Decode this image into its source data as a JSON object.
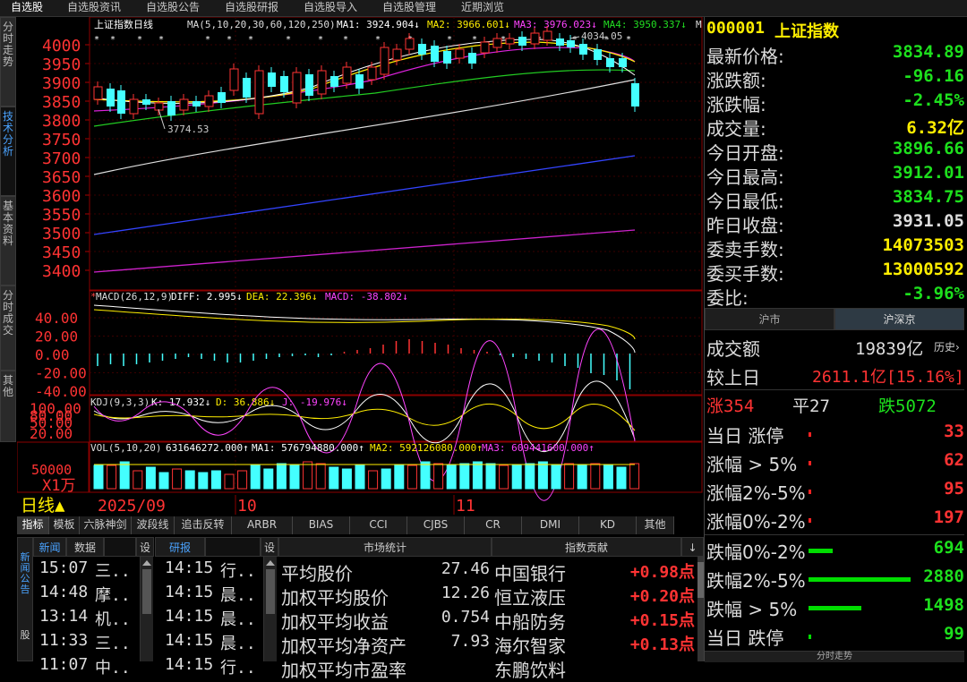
{
  "menu": [
    "自选股",
    "自选股资讯",
    "自选股公告",
    "自选股研报",
    "自选股导入",
    "自选股管理",
    "近期浏览"
  ],
  "left_tabs": [
    "分时走势",
    "技术分析",
    "基本资料",
    "分时成交",
    "其他"
  ],
  "main_chart": {
    "header": "上证指数日线",
    "ma_label": "MA(5,10,20,30,60,120,250)",
    "ma1": "MA1: 3924.904↓",
    "ma2": "MA2: 3966.601↓",
    "ma3": "MA3: 3976.023↓",
    "ma4": "MA4: 3950.337↓",
    "ma5": "M",
    "yticks": [
      "4000",
      "3950",
      "3900",
      "3850",
      "3800",
      "3750",
      "3700",
      "3650",
      "3600",
      "3550",
      "3500",
      "3450",
      "3400"
    ],
    "high_label": "4034.05",
    "low_label": "3774.53"
  },
  "macd": {
    "label": "MACD(26,12,9)",
    "diff": "DIFF: 2.995↓",
    "dea": "DEA: 22.396↓",
    "macd": "MACD: -38.802↓",
    "yticks": [
      "40.00",
      "20.00",
      "0.00",
      "-20.00",
      "-40.00"
    ]
  },
  "kdj": {
    "label": "KDJ(9,3,3)",
    "k": "K: 17.932↓",
    "d": "D: 36.886↓",
    "j": "J: -19.976↓",
    "yticks": [
      "100.00",
      "80.00",
      "50.00",
      "20.00"
    ]
  },
  "vol": {
    "label": "VOL(5,10,20)",
    "v": "631646272.000↑",
    "ma1": "MA1: 576794880.000↑",
    "ma2": "MA2: 592126080.000↑",
    "ma3": "MA3: 609441600.000↑",
    "ytick": "50000",
    "unit": "X1万"
  },
  "timeline": {
    "period": "日线▲",
    "d1": "2025/09",
    "d2": "10",
    "d3": "11"
  },
  "indicator_tabs": [
    "指标",
    "模板",
    "六脉神剑",
    "波段线",
    "追击反转",
    "ARBR",
    "BIAS",
    "CCI",
    "CJBS",
    "CR",
    "DMI",
    "KD",
    "其他"
  ],
  "quote": {
    "code": "000001",
    "name": "上证指数",
    "rows": [
      {
        "label": "最新价格:",
        "value": "3834.89",
        "color": "green"
      },
      {
        "label": "涨跌额:",
        "value": "-96.16",
        "color": "green"
      },
      {
        "label": "涨跌幅:",
        "value": "-2.45%",
        "color": "green"
      },
      {
        "label": "成交量:",
        "value": "6.32亿",
        "color": "yellow"
      },
      {
        "label": "今日开盘:",
        "value": "3896.66",
        "color": "green"
      },
      {
        "label": "今日最高:",
        "value": "3912.01",
        "color": "green"
      },
      {
        "label": "今日最低:",
        "value": "3834.75",
        "color": "green"
      },
      {
        "label": "昨日收盘:",
        "value": "3931.05",
        "color": "white"
      },
      {
        "label": "委卖手数:",
        "value": "14073503",
        "color": "yellow"
      },
      {
        "label": "委买手数:",
        "value": "13000592",
        "color": "yellow"
      },
      {
        "label": "委比:",
        "value": "-3.96%",
        "color": "green"
      }
    ]
  },
  "market_tabs": [
    "沪市",
    "沪深京"
  ],
  "turnover": {
    "label": "成交额",
    "value": "19839亿",
    "hist": "历史›",
    "cmp_label": "较上日",
    "cmp_value": "2611.1亿[15.16%]"
  },
  "breadth": {
    "up": "涨354",
    "flat": "平27",
    "down": "跌5072"
  },
  "dist": [
    {
      "label": "当日 涨停",
      "value": "33",
      "color": "red",
      "fill": 0.005
    },
    {
      "label": "涨幅 > 5%",
      "value": "62",
      "color": "red",
      "fill": 0.01
    },
    {
      "label": "涨幅2%-5%",
      "value": "95",
      "color": "red",
      "fill": 0.015
    },
    {
      "label": "涨幅0%-2%",
      "value": "197",
      "color": "red",
      "fill": 0.03
    },
    {
      "label": "跌幅0%-2%",
      "value": "694",
      "color": "green",
      "fill": 0.24
    },
    {
      "label": "跌幅2%-5%",
      "value": "2880",
      "color": "green",
      "fill": 1.0
    },
    {
      "label": "跌幅 > 5%",
      "value": "1498",
      "color": "green",
      "fill": 0.52
    },
    {
      "label": "当日 跌停",
      "value": "99",
      "color": "green",
      "fill": 0.03
    }
  ],
  "bottom_right_label": "分时走势",
  "news": {
    "tabs": [
      "新闻",
      "数据",
      "设"
    ],
    "side": [
      "新闻公告",
      "股"
    ],
    "items": [
      {
        "t": "15:07",
        "s": "三.."
      },
      {
        "t": "14:48",
        "s": "摩.."
      },
      {
        "t": "13:14",
        "s": "机.."
      },
      {
        "t": "11:33",
        "s": "三.."
      },
      {
        "t": "11:07",
        "s": "中.."
      }
    ]
  },
  "reports": {
    "tabs": [
      "研报",
      "设"
    ],
    "items": [
      {
        "t": "14:15",
        "s": "行.."
      },
      {
        "t": "14:15",
        "s": "晨.."
      },
      {
        "t": "14:15",
        "s": "晨.."
      },
      {
        "t": "14:15",
        "s": "晨.."
      },
      {
        "t": "14:15",
        "s": "行.."
      }
    ]
  },
  "stats": {
    "title": "市场统计",
    "rows": [
      {
        "label": "平均股价",
        "value": "27.46"
      },
      {
        "label": "加权平均股价",
        "value": "12.26"
      },
      {
        "label": "加权平均收益",
        "value": "0.754"
      },
      {
        "label": "加权平均净资产",
        "value": "7.93"
      },
      {
        "label": "加权平均市盈率",
        "value": ""
      }
    ]
  },
  "contrib": {
    "title": "指数贡献",
    "arrow": "↓",
    "rows": [
      {
        "name": "中国银行",
        "value": "+0.98点"
      },
      {
        "name": "恒立液压",
        "value": "+0.20点"
      },
      {
        "name": "中船防务",
        "value": "+0.15点"
      },
      {
        "name": "海尔智家",
        "value": "+0.13点"
      },
      {
        "name": "东鹏饮料",
        "value": ""
      }
    ]
  }
}
